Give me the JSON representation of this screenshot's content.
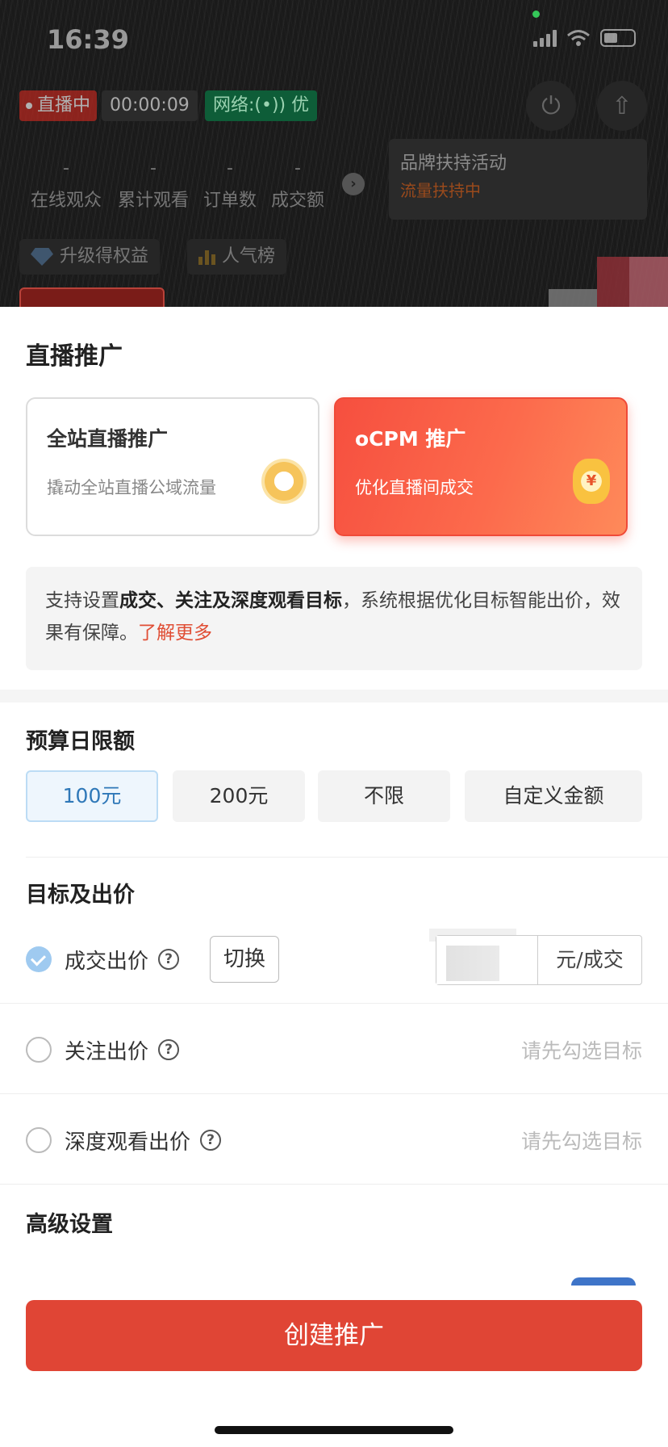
{
  "status_bar": {
    "time": "16:39"
  },
  "live": {
    "badge": "直播中",
    "timer": "00:00:09",
    "network": "网络:(•)) 优",
    "stats": [
      {
        "value": "-",
        "label": "在线观众"
      },
      {
        "value": "-",
        "label": "累计观看"
      },
      {
        "value": "-",
        "label": "订单数"
      },
      {
        "value": "-",
        "label": "成交额"
      }
    ],
    "brand_title": "品牌扶持活动",
    "brand_status": "流量扶持中",
    "pills": [
      "升级得权益",
      "人气榜"
    ]
  },
  "sheet": {
    "title": "直播推广",
    "cards": [
      {
        "title": "全站直播推广",
        "subtitle": "撬动全站直播公域流量"
      },
      {
        "title": "oCPM 推广",
        "subtitle": "优化直播间成交",
        "coin": "¥"
      }
    ],
    "info": {
      "prefix": "支持设置",
      "bold": "成交、关注及深度观看目标",
      "suffix": "，系统根据优化目标智能出价，效果有保障。",
      "link": "了解更多"
    },
    "budget": {
      "title": "预算日限额",
      "options": [
        "100元",
        "200元",
        "不限",
        "自定义金额"
      ],
      "selected": "100元"
    },
    "goals": {
      "title": "目标及出价",
      "deal": {
        "label": "成交出价",
        "switch": "切换",
        "unit": "元/成交"
      },
      "follow": {
        "label": "关注出价",
        "hint": "请先勾选目标"
      },
      "deep_watch": {
        "label": "深度观看出价",
        "hint": "请先勾选目标"
      }
    },
    "advanced": {
      "title": "高级设置"
    },
    "cta": "创建推广"
  },
  "colors": {
    "accent": "#e04535",
    "selected_blue": "#2f78b8",
    "link": "#e04e35"
  }
}
